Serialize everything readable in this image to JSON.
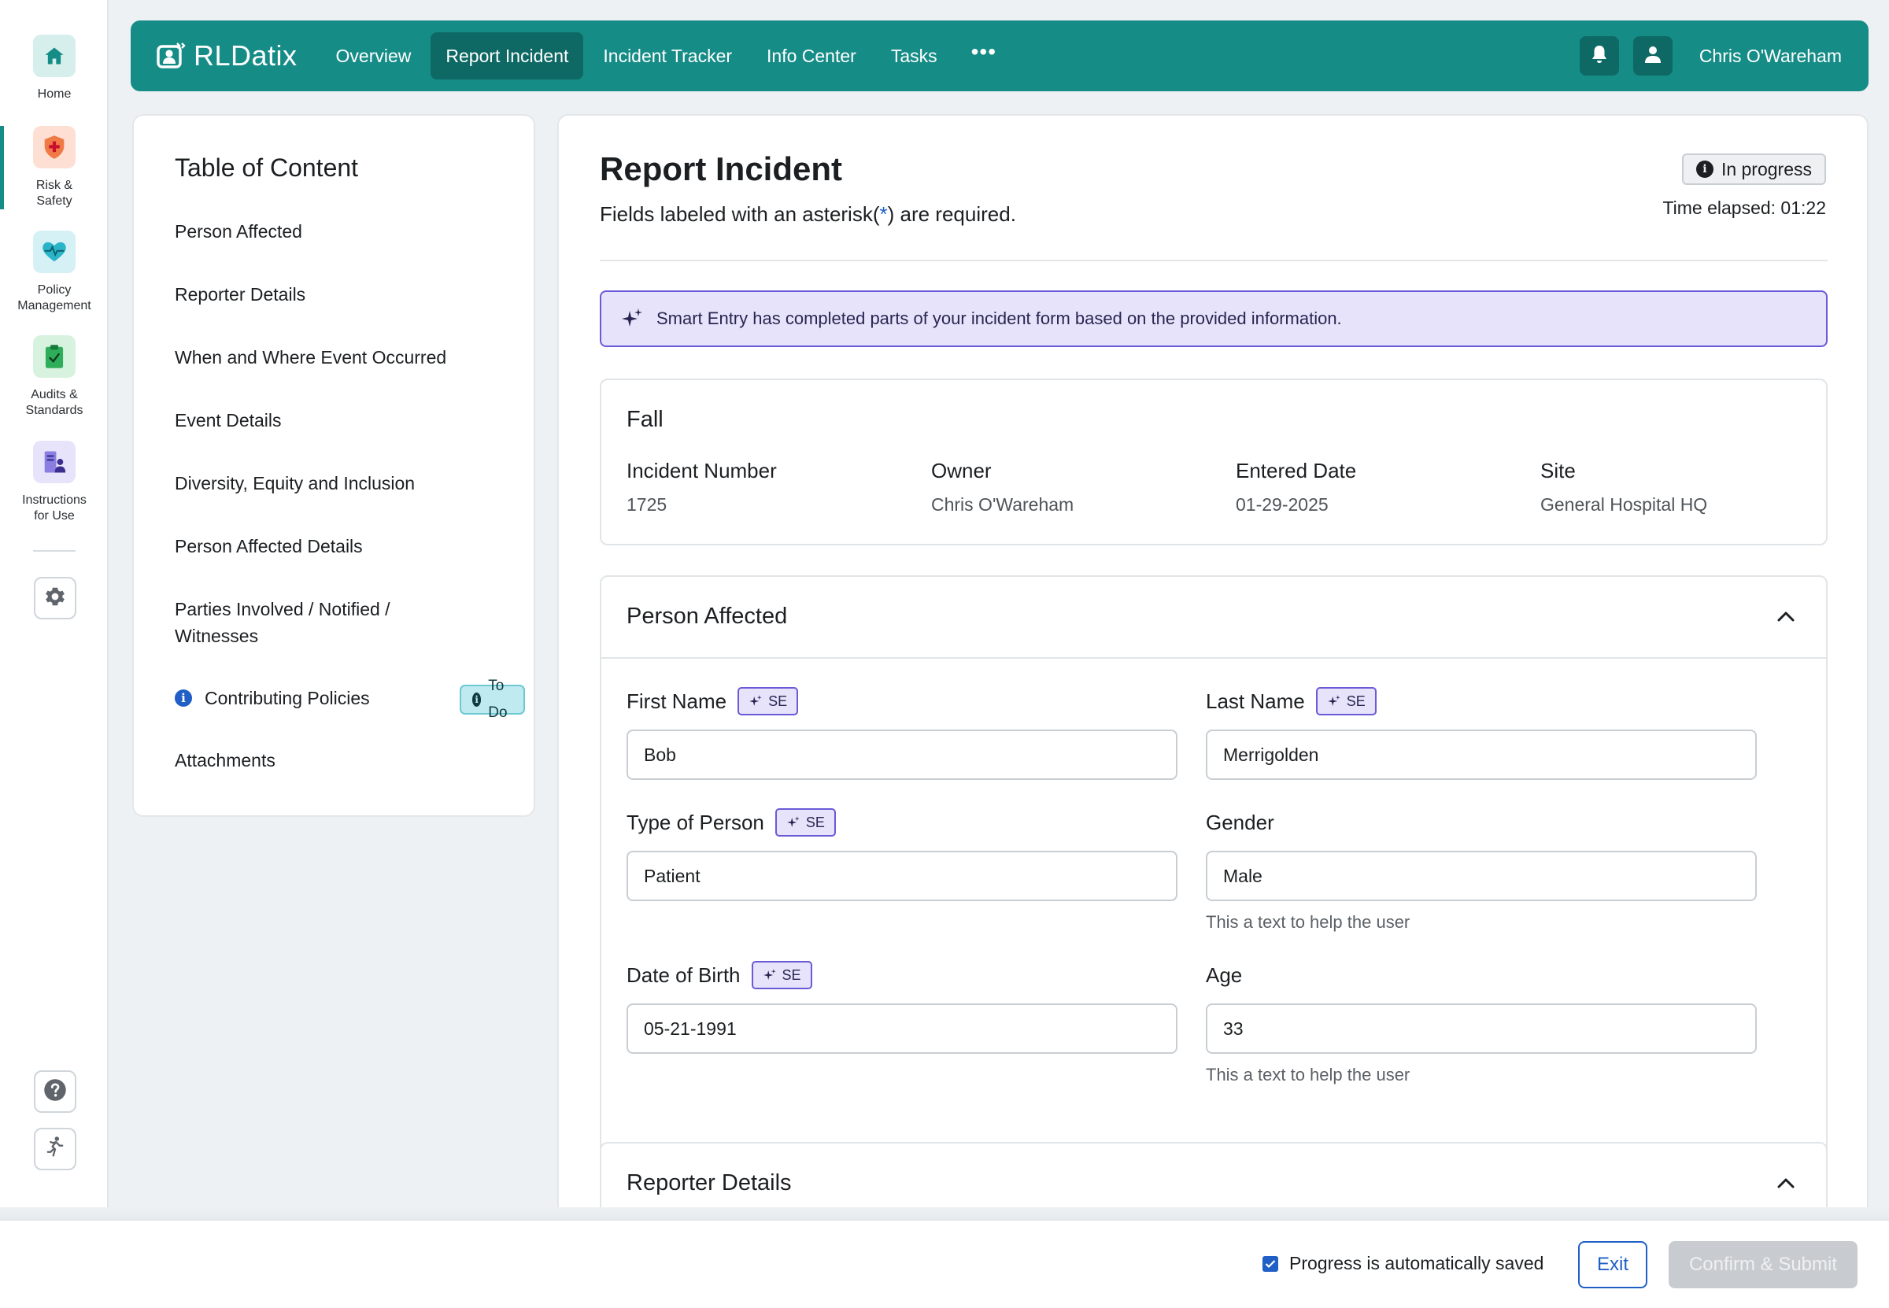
{
  "rail": {
    "items": [
      {
        "label": "Home",
        "icon": "home-icon"
      },
      {
        "label": "Risk &\nSafety",
        "icon": "shield-cross-icon"
      },
      {
        "label": "Policy\nManagement",
        "icon": "heart-pulse-icon"
      },
      {
        "label": "Audits &\nStandards",
        "icon": "clipboard-check-icon"
      },
      {
        "label": "Instructions\nfor Use",
        "icon": "instructions-icon"
      }
    ],
    "settings_icon": "gear-icon",
    "help_icon": "help-icon",
    "exit_icon": "running-person-icon"
  },
  "topnav": {
    "brand": "RLDatix",
    "items": [
      "Overview",
      "Report Incident",
      "Incident Tracker",
      "Info Center",
      "Tasks"
    ],
    "more": "•••",
    "user": "Chris O'Wareham"
  },
  "toc": {
    "title": "Table of Content",
    "items": [
      "Person Affected",
      "Reporter Details",
      "When and Where Event Occurred",
      "Event Details",
      "Diversity, Equity and Inclusion",
      "Person Affected Details",
      "Parties Involved / Notified / Witnesses",
      "Contributing Policies",
      "Attachments"
    ],
    "todo_badge": "To Do"
  },
  "main": {
    "title": "Report Incident",
    "subtitle_pre": "Fields labeled with an asterisk(",
    "subtitle_ast": "*",
    "subtitle_post": ") are required.",
    "status": "In progress",
    "time_elapsed": "Time elapsed: 01:22",
    "smart_banner": "Smart Entry has completed parts of your incident form based on the provided information."
  },
  "summary": {
    "title": "Fall",
    "fields": [
      {
        "label": "Incident Number",
        "value": "1725"
      },
      {
        "label": "Owner",
        "value": "Chris O'Wareham"
      },
      {
        "label": "Entered Date",
        "value": "01-29-2025"
      },
      {
        "label": "Site",
        "value": "General Hospital HQ"
      }
    ]
  },
  "person_affected": {
    "title": "Person Affected",
    "se_label": "SE",
    "first_name": {
      "label": "First Name",
      "value": "Bob"
    },
    "last_name": {
      "label": "Last Name",
      "value": "Merrigolden"
    },
    "type_of_person": {
      "label": "Type of Person",
      "value": "Patient"
    },
    "gender": {
      "label": "Gender",
      "value": "Male",
      "helper": "This a text to help the user"
    },
    "dob": {
      "label": "Date of Birth",
      "value": "05-21-1991"
    },
    "age": {
      "label": "Age",
      "value": "33",
      "helper": "This a text to help the user"
    }
  },
  "reporter_details": {
    "title": "Reporter Details"
  },
  "footer": {
    "autosave": "Progress is automatically saved",
    "exit": "Exit",
    "submit": "Confirm & Submit"
  },
  "colors": {
    "brand": "#168c87",
    "brand_dark": "#0e6964",
    "accent_blue": "#1f5fc6",
    "smart_entry": "#6a5ad8"
  }
}
